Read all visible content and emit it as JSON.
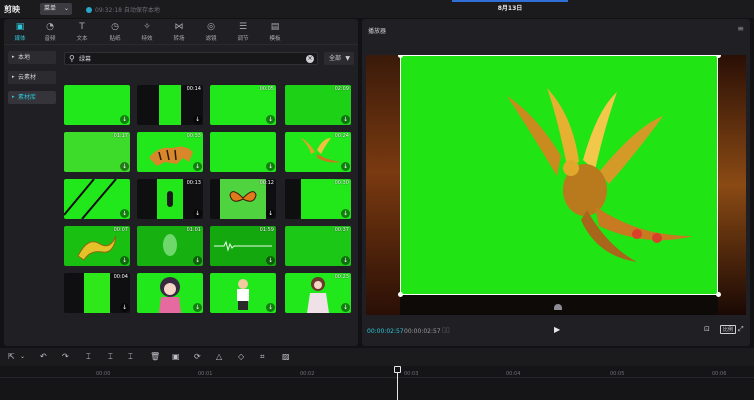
{
  "titlebar": {
    "logo": "剪映",
    "menu_label": "菜单",
    "autosave": "09:32:18 自动保存本地",
    "project_title": "8月13日"
  },
  "tabs": [
    {
      "label": "媒体",
      "icon": "media-icon",
      "glyph": "▣",
      "active": true
    },
    {
      "label": "音频",
      "icon": "audio-icon",
      "glyph": "◔",
      "active": false
    },
    {
      "label": "文本",
      "icon": "text-icon",
      "glyph": "T",
      "active": false
    },
    {
      "label": "贴纸",
      "icon": "sticker-icon",
      "glyph": "◷",
      "active": false
    },
    {
      "label": "特效",
      "icon": "effects-icon",
      "glyph": "✧",
      "active": false
    },
    {
      "label": "转场",
      "icon": "transition-icon",
      "glyph": "⋈",
      "active": false
    },
    {
      "label": "滤镜",
      "icon": "filter-icon",
      "glyph": "◎",
      "active": false
    },
    {
      "label": "调节",
      "icon": "adjust-icon",
      "glyph": "☰",
      "active": false
    },
    {
      "label": "模板",
      "icon": "template-icon",
      "glyph": "▤",
      "active": false
    }
  ],
  "side_nav": [
    {
      "label": "本地",
      "active": false
    },
    {
      "label": "云素材",
      "active": false
    },
    {
      "label": "素材库",
      "active": true
    }
  ],
  "search": {
    "value": "绿幕",
    "placeholder": ""
  },
  "filter": {
    "label": "全部"
  },
  "thumbnails": [
    {
      "duration": "",
      "style": "green"
    },
    {
      "duration": "00:14",
      "style": "green-bar"
    },
    {
      "duration": "00:05",
      "style": "green"
    },
    {
      "duration": "02:09",
      "style": "green-noise"
    },
    {
      "duration": "01:17",
      "style": "green"
    },
    {
      "duration": "00:33",
      "style": "tiger"
    },
    {
      "duration": "",
      "style": "green"
    },
    {
      "duration": "00:24",
      "style": "phoenix"
    },
    {
      "duration": "",
      "style": "green-stripes"
    },
    {
      "duration": "00:13",
      "style": "figure"
    },
    {
      "duration": "00:12",
      "style": "butterfly"
    },
    {
      "duration": "00:30",
      "style": "green-half"
    },
    {
      "duration": "00:07",
      "style": "dragon"
    },
    {
      "duration": "01:01",
      "style": "green-glow"
    },
    {
      "duration": "01:59",
      "style": "green-wave"
    },
    {
      "duration": "00:37",
      "style": "green-noise"
    },
    {
      "duration": "00:04",
      "style": "green-bar"
    },
    {
      "duration": "",
      "style": "anime-girl"
    },
    {
      "duration": "",
      "style": "cartoon-man"
    },
    {
      "duration": "00:23",
      "style": "anime-girl-2"
    }
  ],
  "preview": {
    "title": "播放器",
    "timecode_current": "00:00:02:57",
    "timecode_total": "00:00:02:57",
    "ratio_label": "比例"
  },
  "timeline": {
    "ticks": [
      "00:00",
      "00:01",
      "00:02",
      "00:03",
      "00:04",
      "00:05",
      "00:06"
    ]
  },
  "colors": {
    "accent": "#2fc6d8",
    "chroma_green": "#21e414",
    "panel": "#202024",
    "background": "#121214"
  }
}
